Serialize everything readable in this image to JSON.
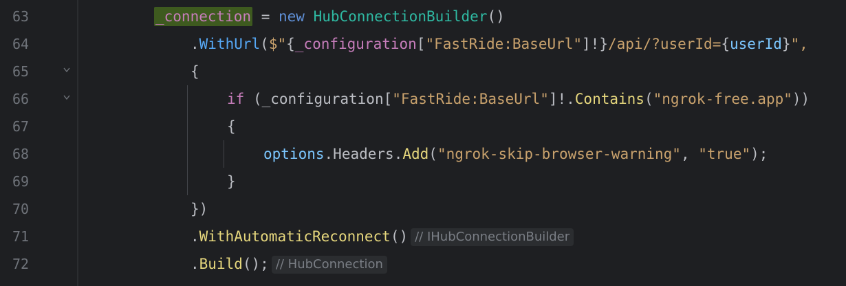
{
  "lines": [
    {
      "num": "63"
    },
    {
      "num": "64"
    },
    {
      "num": "65"
    },
    {
      "num": "66"
    },
    {
      "num": "67"
    },
    {
      "num": "68"
    },
    {
      "num": "69"
    },
    {
      "num": "70"
    },
    {
      "num": "71"
    },
    {
      "num": "72"
    }
  ],
  "code": {
    "l63": {
      "field": "_connection",
      "eq": " = ",
      "new": "new",
      "type": " HubConnectionBuilder",
      "paren": "()"
    },
    "l64": {
      "dot": ".",
      "method": "WithUrl",
      "open": "(",
      "dollar": "$\"",
      "brace_open": "{",
      "config": "_configuration",
      "bracket_open": "[",
      "key": "\"FastRide:BaseUrl\"",
      "bracket_close": "]!",
      "brace_close": "}",
      "path": "/api/?userId=",
      "brace2_open": "{",
      "param": "userId",
      "brace2_close": "}",
      "quote_end": "\","
    },
    "l65": {
      "text": "{"
    },
    "l66": {
      "if": "if",
      "open": " (",
      "config": "_configuration",
      "bracket_open": "[",
      "key": "\"FastRide:BaseUrl\"",
      "bracket_close": "]!.",
      "method": "Contains",
      "popen": "(",
      "arg": "\"ngrok-free.app\"",
      "pclose": "))"
    },
    "l67": {
      "text": "{"
    },
    "l68": {
      "options": "options",
      "dot1": ".",
      "headers": "Headers",
      "dot2": ".",
      "method": "Add",
      "open": "(",
      "arg1": "\"ngrok-skip-browser-warning\"",
      "comma": ", ",
      "arg2": "\"true\"",
      "close": ");"
    },
    "l69": {
      "text": "}"
    },
    "l70": {
      "text": "})"
    },
    "l71": {
      "dot": ".",
      "method": "WithAutomaticReconnect",
      "paren": "()",
      "hint": "// IHubConnectionBuilder"
    },
    "l72": {
      "dot": ".",
      "method": "Build",
      "paren": "();",
      "hint": "// HubConnection"
    }
  },
  "colors": {
    "background": "#1e1f22",
    "field": "#c77dbb",
    "highlight": "#3e5a1f",
    "string": "#6aab73",
    "method": "#56a8f5",
    "type": "#2fbaa3",
    "keyword": "#5f8fd6"
  },
  "icons": {
    "fold": "chevron-down-icon"
  }
}
